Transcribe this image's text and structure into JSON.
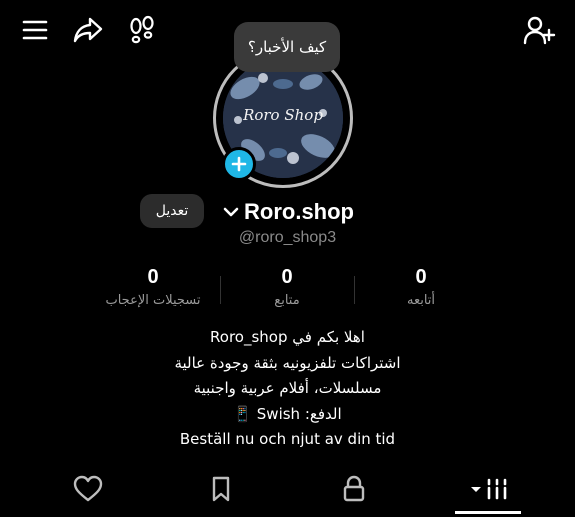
{
  "header": {
    "menu_icon": "hamburger-menu-icon",
    "share_icon": "share-arrow-icon",
    "footprints_icon": "footprints-icon",
    "add_user_icon": "add-user-icon"
  },
  "profile": {
    "bubble_text": "كيف الأخبار؟",
    "avatar_logo_text": "Roro Shop",
    "edit_label": "تعديل",
    "display_name": "Roro.shop",
    "handle": "@roro_shop3"
  },
  "stats": [
    {
      "value": "0",
      "label": "أتابعه"
    },
    {
      "value": "0",
      "label": "متابع"
    },
    {
      "value": "0",
      "label": "تسجيلات الإعجاب"
    }
  ],
  "bio": [
    "اهلا بكم في Roro_shop",
    "اشتراكات تلفزيونيه بثقة وجودة عالية",
    "مسلسلات، أفلام عربية واجنبية",
    "الدفع: Swish 📱",
    "Beställ nu och njut av din tid"
  ],
  "tabs": [
    {
      "icon": "grid-dropdown-icon",
      "active": true
    },
    {
      "icon": "lock-icon",
      "active": false
    },
    {
      "icon": "bookmark-icon",
      "active": false
    },
    {
      "icon": "heart-icon",
      "active": false
    }
  ],
  "colors": {
    "background": "#000000",
    "accent": "#1fb7e6",
    "muted_text": "#8a8a8a",
    "bubble_bg": "#3a3a3a"
  }
}
